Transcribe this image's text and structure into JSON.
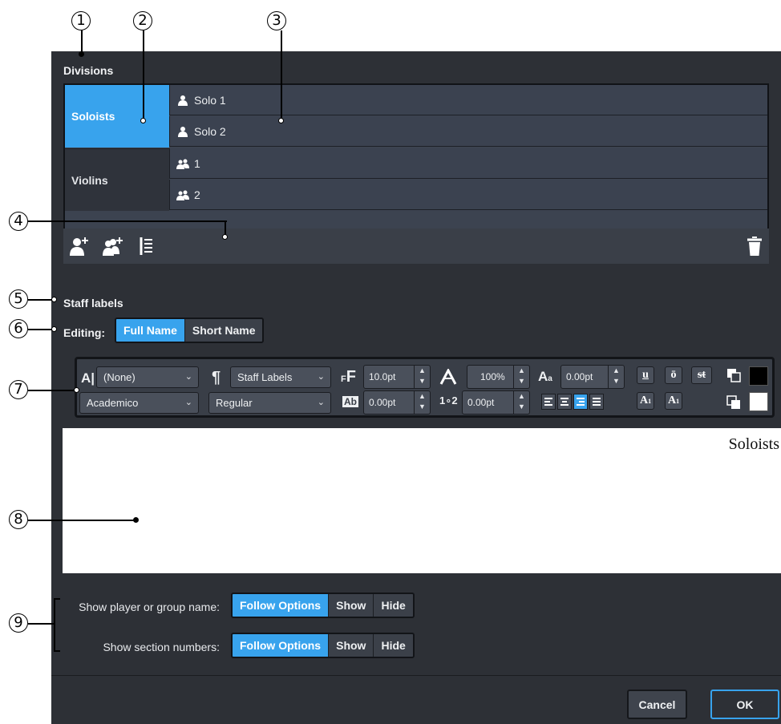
{
  "callouts": [
    "1",
    "2",
    "3",
    "4",
    "5",
    "6",
    "7",
    "8",
    "9"
  ],
  "divisions": {
    "label": "Divisions",
    "groups": [
      {
        "name": "Soloists",
        "players": [
          "Solo 1",
          "Solo 2"
        ],
        "player_icon": "single-player-icon"
      },
      {
        "name": "Violins",
        "players": [
          "1",
          "2"
        ],
        "player_icon": "section-player-icon"
      }
    ],
    "toolbar": [
      "add-single-player-icon",
      "add-section-player-icon",
      "add-group-icon",
      "trash-icon"
    ]
  },
  "staff_labels": {
    "label": "Staff labels",
    "editing_label": "Editing:",
    "editing_options": [
      "Full Name",
      "Short Name"
    ],
    "editing_active": "Full Name"
  },
  "format": {
    "char_style": "(None)",
    "para_style": "Staff Labels",
    "font": "Academico",
    "font_style": "Regular",
    "size": "10.0pt",
    "width": "100%",
    "baseline": "0.00pt",
    "tracking": "0.00pt",
    "spacing": "0.00pt",
    "bold_tool_labels": [
      "u",
      "ō",
      "st"
    ],
    "script_labels": [
      "A",
      "A"
    ],
    "script_sub": [
      "1",
      "1"
    ],
    "alignment_active": "right",
    "colors": {
      "foreground": "#000000",
      "background": "#ffffff",
      "accent": "#38a3ed"
    }
  },
  "preview": {
    "text": "Soloists"
  },
  "show_options": [
    {
      "label": "Show player or group name:",
      "options": [
        "Follow Options",
        "Show",
        "Hide"
      ],
      "active": "Follow Options"
    },
    {
      "label": "Show section numbers:",
      "options": [
        "Follow Options",
        "Show",
        "Hide"
      ],
      "active": "Follow Options"
    }
  ],
  "footer": {
    "cancel": "Cancel",
    "ok": "OK"
  }
}
